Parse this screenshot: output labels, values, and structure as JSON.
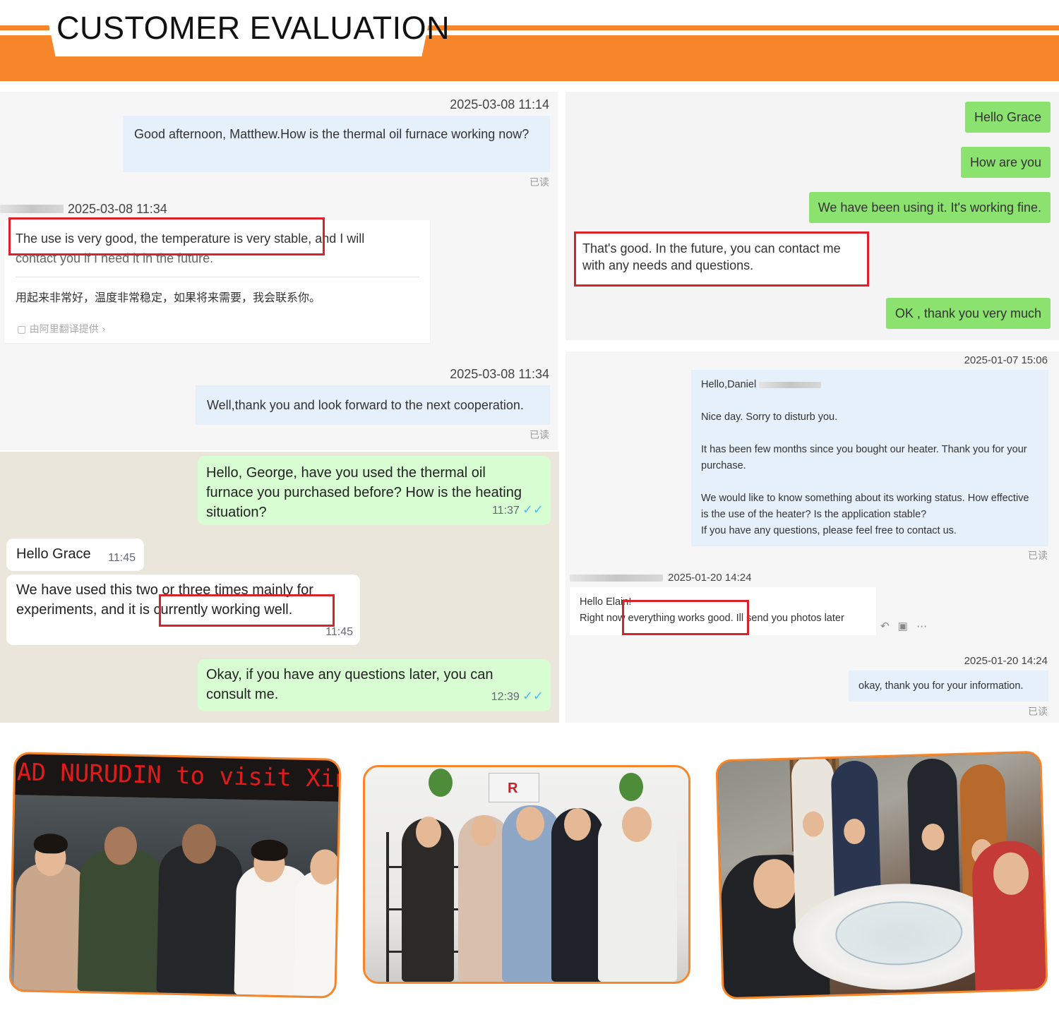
{
  "header": {
    "title": "CUSTOMER EVALUATION"
  },
  "chat_a": {
    "msg1_time": "2025-03-08 11:14",
    "msg1_text": "Good afternoon, Matthew.How is the thermal oil furnace working now?",
    "msg1_read": "已读",
    "msg2_time": "2025-03-08 11:34",
    "msg2_text_line1": "The use is very good, the temperature is very stable, and I will",
    "msg2_text_line2": "contact you if I need it in the future.",
    "msg2_translation": "用起来非常好，温度非常稳定，如果将来需要，我会联系你。",
    "msg2_translated_by": "由阿里翻译提供",
    "msg3_time": "2025-03-08 11:34",
    "msg3_text": "Well,thank you and look forward to the next cooperation.",
    "msg3_read": "已读"
  },
  "chat_b": {
    "msg1_text": "Hello, George, have you used the thermal oil furnace you purchased before? How is the heating situation?",
    "msg1_time": "11:37",
    "msg2_text": "Hello Grace",
    "msg2_time": "11:45",
    "msg3_text": "We have used this two or three times mainly for experiments, and it is currently working well.",
    "msg3_time": "11:45",
    "msg4_text": "Okay, if you have any questions later, you can consult me.",
    "msg4_time": "12:39",
    "tick_glyph": "✓✓"
  },
  "chat_c": {
    "msg1": "Hello Grace",
    "msg2": "How are you",
    "msg3": "We have been using it. It's working fine.",
    "msg4": "That's good. In the future, you can contact me with any needs and questions.",
    "msg5": "OK , thank you very much"
  },
  "chat_d": {
    "msg1_time": "2025-01-07 15:06",
    "msg1_greeting": "Hello,Daniel",
    "msg1_p1": "Nice day. Sorry to disturb you.",
    "msg1_p2": "It has been few months since you bought our heater. Thank you for your purchase.",
    "msg1_p3": "We would like to know something about its working status. How effective is the use of the heater? Is the application stable?",
    "msg1_p4": "If you have any questions, please feel free to contact us.",
    "msg1_read": "已读",
    "msg2_time": "2025-01-20 14:24",
    "msg2_line1": "Hello Elain!",
    "msg2_line2": "Right now everything works good. Ill send you photos later",
    "msg3_time": "2025-01-20 14:24",
    "msg3_text": "okay, thank you for your information.",
    "msg3_read": "已读"
  },
  "photos": {
    "photo1_led": "AD NURUDIN to visit Xinrong !"
  },
  "colors": {
    "accent": "#f7862b",
    "highlight": "#d8232a"
  }
}
